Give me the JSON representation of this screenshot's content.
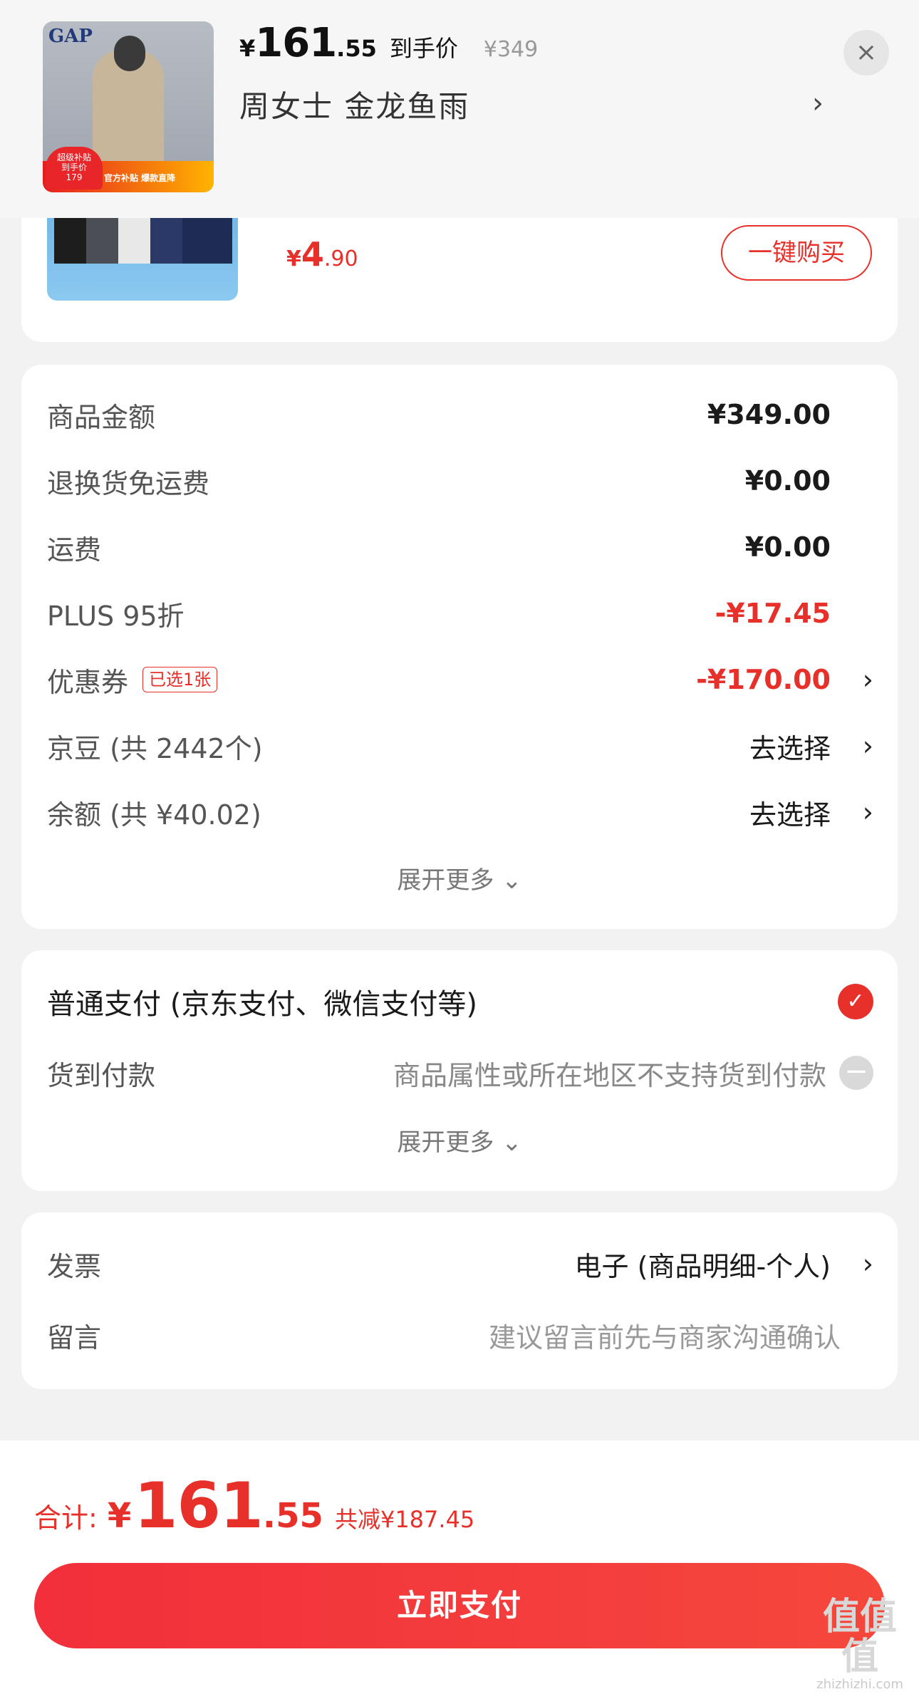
{
  "top_summary": {
    "price_yen": "¥",
    "price_int": "161",
    "price_dec": ".55",
    "price_label": "到手价",
    "original_price": "¥349",
    "product_name": "周女士  金龙鱼雨",
    "chevron": "›",
    "close": "×",
    "thumb_logo": "GAP",
    "thumb_promo_price_line1": "超级补贴",
    "thumb_promo_price_line2": "到手价",
    "thumb_promo_price_value": "179",
    "thumb_promo_text": "官方补贴 爆款直降"
  },
  "recommend": {
    "price_yen": "¥",
    "price_int": "4",
    "price_dec": ".90",
    "buy_button": "一键购买"
  },
  "price_breakdown": {
    "rows": [
      {
        "label": "商品金额",
        "value": "¥349.00"
      },
      {
        "label": "退换货免运费",
        "value": "¥0.00"
      },
      {
        "label": "运费",
        "value": "¥0.00"
      },
      {
        "label": "PLUS 95折",
        "value": "-¥17.45"
      },
      {
        "label": "优惠券",
        "tag": "已选1张",
        "value": "-¥170.00"
      },
      {
        "label": "京豆 (共 2442个)",
        "value": "去选择"
      },
      {
        "label": "余额 (共 ¥40.02)",
        "value": "去选择"
      }
    ],
    "expand": "展开更多 ⌄"
  },
  "payment": {
    "normal_label": "普通支付 (京东支付、微信支付等)",
    "cod_label": "货到付款",
    "cod_note": "商品属性或所在地区不支持货到付款",
    "expand": "展开更多 ⌄"
  },
  "invoice": {
    "label": "发票",
    "value": "电子 (商品明细-个人)",
    "message_label": "留言",
    "message_placeholder": "建议留言前先与商家沟通确认"
  },
  "bottom": {
    "total_label": "合计:",
    "total_yen": "¥",
    "total_int": "161",
    "total_dec": ".55",
    "saved": "共减¥187.45",
    "pay_button": "立即支付"
  },
  "watermark": {
    "mark": "值值值",
    "url": "zhizhizhi.com"
  },
  "colors": {
    "accent_red": "#e8302a",
    "background": "#f2f2f2"
  }
}
